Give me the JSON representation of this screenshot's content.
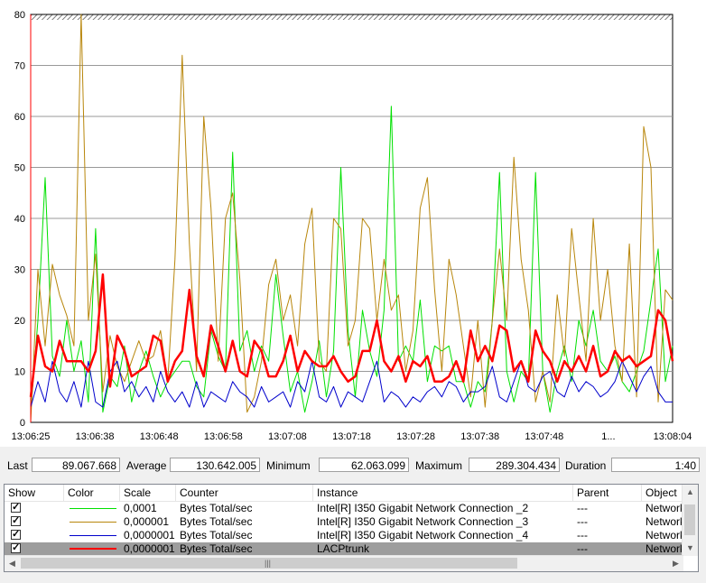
{
  "chart_data": {
    "type": "line",
    "ylim": [
      0,
      80
    ],
    "yticks": [
      "0",
      "10",
      "20",
      "30",
      "40",
      "50",
      "60",
      "70",
      "80"
    ],
    "xlabels": [
      "13:06:25",
      "13:06:38",
      "13:06:48",
      "13:06:58",
      "13:07:08",
      "13:07:18",
      "13:07:28",
      "13:07:38",
      "13:07:48",
      "1...",
      "13:08:04"
    ],
    "grid": true,
    "series": [
      {
        "color": "#00e000",
        "width": 1,
        "values": [
          2,
          20,
          48,
          13,
          9,
          20,
          10,
          16,
          4,
          38,
          2,
          9,
          7,
          15,
          4,
          10,
          14,
          9,
          5,
          8,
          10,
          12,
          12,
          7,
          5,
          18,
          13,
          10,
          53,
          14,
          18,
          10,
          15,
          12,
          29,
          17,
          6,
          10,
          2,
          8,
          16,
          5,
          14,
          50,
          18,
          5,
          22,
          14,
          9,
          22,
          62,
          12,
          15,
          12,
          24,
          8,
          15,
          14,
          15,
          8,
          8,
          3,
          8,
          6,
          20,
          49,
          10,
          4,
          10,
          8,
          49,
          10,
          2,
          10,
          15,
          8,
          20,
          15,
          22,
          12,
          10,
          13,
          8,
          6,
          10,
          14,
          24,
          34,
          8,
          15
        ]
      },
      {
        "color": "#b8860b",
        "width": 1,
        "values": [
          0,
          30,
          15,
          31,
          25,
          21,
          15,
          82,
          20,
          33,
          6,
          17,
          11,
          8,
          12,
          16,
          12,
          13,
          18,
          8,
          32,
          72,
          35,
          10,
          60,
          42,
          12,
          40,
          45,
          28,
          2,
          5,
          12,
          27,
          32,
          20,
          25,
          15,
          35,
          42,
          12,
          10,
          40,
          38,
          15,
          20,
          40,
          38,
          20,
          32,
          22,
          25,
          10,
          18,
          42,
          48,
          26,
          10,
          32,
          25,
          15,
          5,
          20,
          3,
          20,
          34,
          20,
          52,
          32,
          22,
          4,
          10,
          4,
          25,
          13,
          38,
          25,
          12,
          40,
          20,
          30,
          15,
          8,
          35,
          5,
          58,
          50,
          4,
          26,
          24
        ]
      },
      {
        "color": "#0000cc",
        "width": 1,
        "values": [
          3,
          8,
          4,
          12,
          6,
          4,
          8,
          3,
          12,
          4,
          3,
          10,
          12,
          6,
          8,
          5,
          7,
          4,
          10,
          6,
          4,
          6,
          3,
          8,
          3,
          6,
          5,
          4,
          8,
          6,
          5,
          3,
          7,
          4,
          5,
          6,
          3,
          8,
          6,
          12,
          5,
          4,
          7,
          3,
          6,
          5,
          4,
          8,
          12,
          4,
          6,
          5,
          3,
          5,
          4,
          6,
          7,
          5,
          8,
          7,
          4,
          6,
          6,
          7,
          11,
          5,
          4,
          8,
          12,
          7,
          6,
          9,
          10,
          6,
          5,
          9,
          6,
          8,
          7,
          5,
          6,
          8,
          12,
          9,
          6,
          9,
          11,
          6,
          4,
          4
        ]
      },
      {
        "color": "#ff0000",
        "width": 2.5,
        "values": [
          5,
          17,
          11,
          10,
          16,
          12,
          12,
          12,
          10,
          14,
          29,
          7,
          17,
          14,
          9,
          10,
          11,
          17,
          16,
          8,
          12,
          14,
          26,
          13,
          9,
          19,
          15,
          10,
          16,
          10,
          9,
          16,
          14,
          9,
          9,
          12,
          17,
          10,
          14,
          12,
          11,
          11,
          13,
          10,
          8,
          9,
          14,
          14,
          20,
          12,
          10,
          13,
          8,
          12,
          11,
          13,
          8,
          8,
          9,
          12,
          8,
          18,
          12,
          15,
          12,
          19,
          18,
          10,
          12,
          8,
          18,
          14,
          12,
          8,
          12,
          10,
          13,
          10,
          15,
          9,
          10,
          14,
          12,
          13,
          11,
          12,
          13,
          22,
          20,
          12
        ]
      }
    ]
  },
  "stats": {
    "last_label": "Last",
    "last_value": "89.067.668",
    "average_label": "Average",
    "average_value": "130.642.005",
    "minimum_label": "Minimum",
    "minimum_value": "62.063.099",
    "maximum_label": "Maximum",
    "maximum_value": "289.304.434",
    "duration_label": "Duration",
    "duration_value": "1:40"
  },
  "legend": {
    "headers": {
      "show": "Show",
      "color": "Color",
      "scale": "Scale",
      "counter": "Counter",
      "instance": "Instance",
      "parent": "Parent",
      "object": "Object"
    },
    "rows": [
      {
        "color": "#00e000",
        "scale": "0,0001",
        "counter": "Bytes Total/sec",
        "instance": "Intel[R] I350 Gigabit Network Connection _2",
        "parent": "---",
        "object": "Network"
      },
      {
        "color": "#b8860b",
        "scale": "0,000001",
        "counter": "Bytes Total/sec",
        "instance": "Intel[R] I350 Gigabit Network Connection _3",
        "parent": "---",
        "object": "Network"
      },
      {
        "color": "#0000cc",
        "scale": "0,0000001",
        "counter": "Bytes Total/sec",
        "instance": "Intel[R] I350 Gigabit Network Connection _4",
        "parent": "---",
        "object": "Network"
      },
      {
        "color": "#ff0000",
        "scale": "0,0000001",
        "counter": "Bytes Total/sec",
        "instance": "LACPtrunk",
        "parent": "---",
        "object": "Network"
      }
    ]
  }
}
